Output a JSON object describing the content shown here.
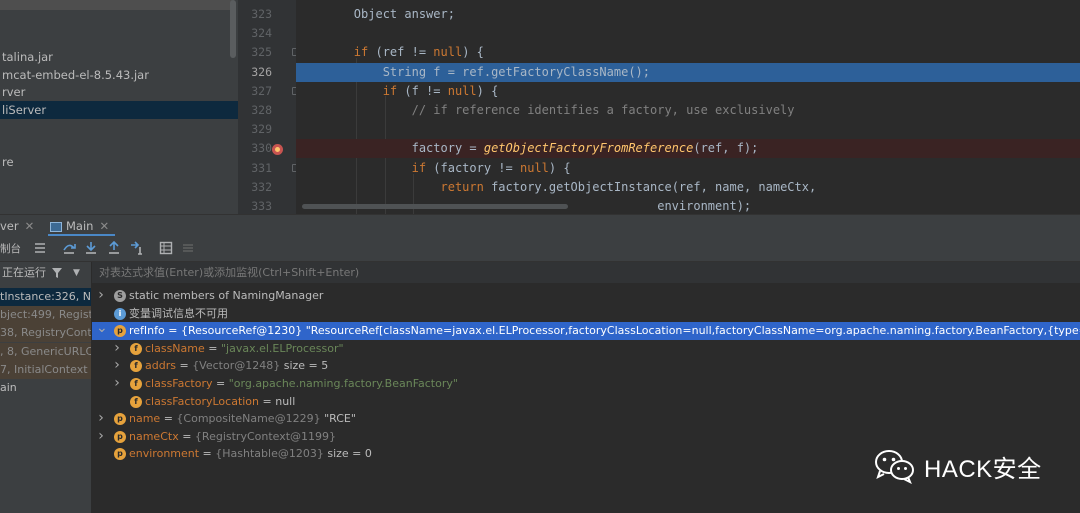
{
  "project_tree": {
    "items": [
      {
        "label": "talina.jar",
        "selected": false
      },
      {
        "label": "mcat-embed-el-8.5.43.jar",
        "selected": false
      },
      {
        "label": "rver",
        "selected": false
      },
      {
        "label": "liServer",
        "selected": true
      },
      {
        "label": "re",
        "selected": false
      }
    ]
  },
  "editor": {
    "lines": [
      {
        "num": "323",
        "code": [
          {
            "t": "        Object answer;",
            "c": ""
          }
        ]
      },
      {
        "num": "324",
        "code": []
      },
      {
        "num": "325",
        "code": [
          {
            "t": "        ",
            "c": ""
          },
          {
            "t": "if",
            "c": "kw"
          },
          {
            "t": " (ref != ",
            "c": ""
          },
          {
            "t": "null",
            "c": "kw"
          },
          {
            "t": ") {",
            "c": ""
          }
        ]
      },
      {
        "num": "326",
        "code": [
          {
            "t": "            String f = ref.getFactoryClassName();",
            "c": ""
          }
        ],
        "current": true
      },
      {
        "num": "327",
        "code": [
          {
            "t": "            ",
            "c": ""
          },
          {
            "t": "if",
            "c": "kw"
          },
          {
            "t": " (f != ",
            "c": ""
          },
          {
            "t": "null",
            "c": "kw"
          },
          {
            "t": ") {",
            "c": ""
          }
        ]
      },
      {
        "num": "328",
        "code": [
          {
            "t": "                // if reference identifies a factory, use exclusively",
            "c": "cm"
          }
        ]
      },
      {
        "num": "329",
        "code": []
      },
      {
        "num": "330",
        "code": [
          {
            "t": "                factory = ",
            "c": ""
          },
          {
            "t": "getObjectFactoryFromReference",
            "c": "it"
          },
          {
            "t": "(ref, f);",
            "c": ""
          }
        ],
        "breakpoint": true
      },
      {
        "num": "331",
        "code": [
          {
            "t": "                ",
            "c": ""
          },
          {
            "t": "if",
            "c": "kw"
          },
          {
            "t": " (factory != ",
            "c": ""
          },
          {
            "t": "null",
            "c": "kw"
          },
          {
            "t": ") {",
            "c": ""
          }
        ]
      },
      {
        "num": "332",
        "code": [
          {
            "t": "                    ",
            "c": ""
          },
          {
            "t": "return",
            "c": "kw"
          },
          {
            "t": " factory.getObjectInstance(ref, name, nameCtx,",
            "c": ""
          }
        ]
      },
      {
        "num": "333",
        "code": [
          {
            "t": "                                                  environment);",
            "c": ""
          }
        ]
      }
    ]
  },
  "debug": {
    "tabs": [
      {
        "label": "ver",
        "active": false
      },
      {
        "label": "Main",
        "active": true
      }
    ],
    "toolbar_label": "制台",
    "thread_label": "正在运行",
    "watch_placeholder": "对表达式求值(Enter)或添加监视(Ctrl+Shift+Enter)",
    "frames": [
      {
        "label": "tInstance:326, Nam",
        "selected": true,
        "lib": false
      },
      {
        "label": "bject:499, Registry",
        "selected": false,
        "lib": true
      },
      {
        "label": "38, RegistryContex",
        "selected": false,
        "lib": true
      },
      {
        "label": ", 8, GenericURLCon",
        "selected": false,
        "lib": true
      },
      {
        "label": "7, InitialContext (j",
        "selected": false,
        "lib": true
      },
      {
        "label": "ain",
        "selected": false,
        "lib": false
      }
    ],
    "variables": [
      {
        "indent": 0,
        "arrow": ">",
        "icon": "s",
        "icon_text": "S",
        "name": "static members of NamingManager",
        "name_class": "plain",
        "type": "",
        "value": "",
        "value_class": ""
      },
      {
        "indent": 0,
        "arrow": "",
        "icon": "i",
        "icon_text": "i",
        "name": "变量调试信息不可用",
        "name_class": "plain",
        "type": "",
        "value": "",
        "value_class": ""
      },
      {
        "indent": 0,
        "arrow": "v",
        "icon": "p",
        "icon_text": "p",
        "name": "refInfo",
        "name_class": "",
        "type": "{ResourceRef@1230}",
        "value": "\"ResourceRef[className=javax.el.ELProcessor,factoryClassLocation=null,factoryClassName=org.apache.naming.factory.BeanFactory,{type=scope,content=},{",
        "value_class": "vstr",
        "selected": true
      },
      {
        "indent": 1,
        "arrow": ">",
        "icon": "f",
        "icon_text": "f",
        "name": "className",
        "name_class": "",
        "type": "",
        "value": "\"javax.el.ELProcessor\"",
        "value_class": "vstr"
      },
      {
        "indent": 1,
        "arrow": ">",
        "icon": "f",
        "icon_text": "f",
        "name": "addrs",
        "name_class": "",
        "type": "{Vector@1248}",
        "value": "size = 5",
        "value_class": "vnum"
      },
      {
        "indent": 1,
        "arrow": ">",
        "icon": "f",
        "icon_text": "f",
        "name": "classFactory",
        "name_class": "",
        "type": "",
        "value": "\"org.apache.naming.factory.BeanFactory\"",
        "value_class": "vstr"
      },
      {
        "indent": 1,
        "arrow": "",
        "icon": "f",
        "icon_text": "f",
        "name": "classFactoryLocation",
        "name_class": "",
        "type": "",
        "value": "null",
        "value_class": "vnum"
      },
      {
        "indent": 0,
        "arrow": ">",
        "icon": "p",
        "icon_text": "p",
        "name": "name",
        "name_class": "",
        "type": "{CompositeName@1229}",
        "value": "\"RCE\"",
        "value_class": "vnum"
      },
      {
        "indent": 0,
        "arrow": ">",
        "icon": "p",
        "icon_text": "p",
        "name": "nameCtx",
        "name_class": "",
        "type": "{RegistryContext@1199}",
        "value": "",
        "value_class": ""
      },
      {
        "indent": 0,
        "arrow": "",
        "icon": "p",
        "icon_text": "p",
        "name": "environment",
        "name_class": "",
        "type": "{Hashtable@1203}",
        "value": "size = 0",
        "value_class": "vnum"
      }
    ]
  },
  "watermark": {
    "text": "HACK安全",
    "icon": "wechat-icon"
  },
  "colors": {
    "accent": "#2f65ca",
    "current_line": "#2d6099",
    "breakpoint": "#c75450"
  }
}
